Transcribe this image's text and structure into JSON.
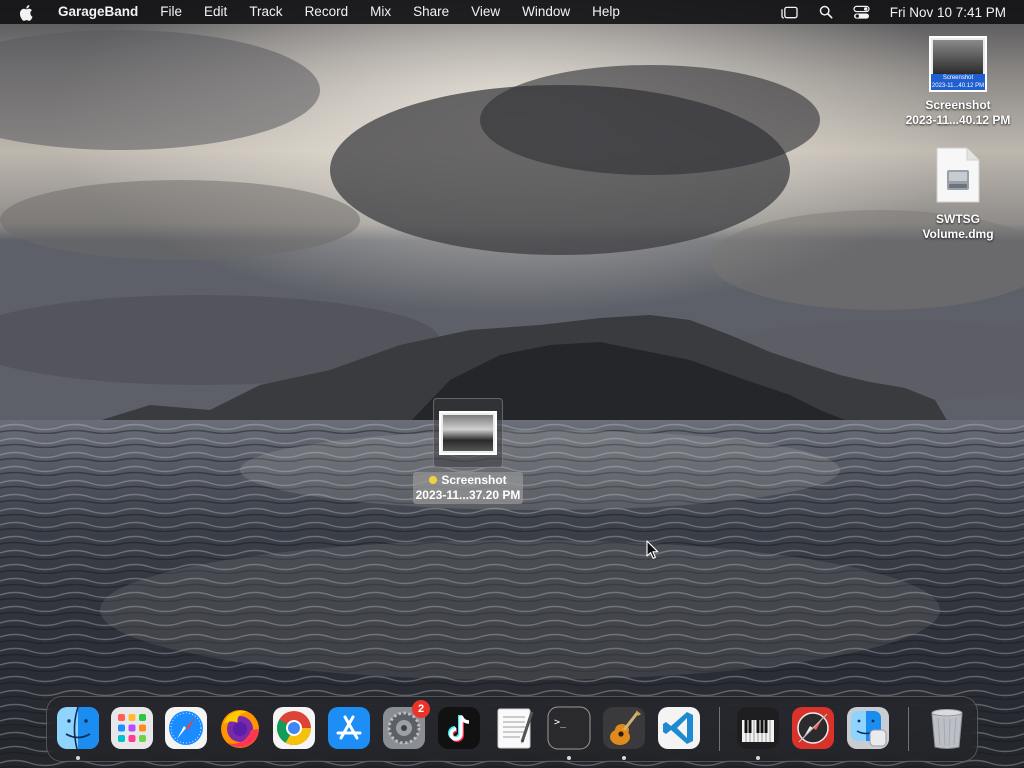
{
  "menubar": {
    "app_name": "GarageBand",
    "menus": [
      "File",
      "Edit",
      "Track",
      "Record",
      "Mix",
      "Share",
      "View",
      "Window",
      "Help"
    ],
    "status_icons": [
      "stage-manager-icon",
      "spotlight-search-icon",
      "control-center-icon"
    ],
    "clock": "Fri Nov 10  7:41 PM"
  },
  "desktop": {
    "icons": [
      {
        "name": "Screenshot",
        "subtitle": "2023-11...40.12 PM",
        "kind": "screenshot"
      },
      {
        "name": "SWTSG",
        "subtitle": "Volume.dmg",
        "kind": "disk-image"
      },
      {
        "name": "Screenshot",
        "subtitle": "2023-11...37.20 PM",
        "kind": "screenshot",
        "selected": true,
        "tag_color": "#f4d03f"
      }
    ],
    "thumb_caption": "Screenshot\n2023-11...40.12 PM"
  },
  "dock": {
    "apps": [
      {
        "name": "Finder",
        "icon": "finder-icon",
        "running": true
      },
      {
        "name": "Launchpad",
        "icon": "launchpad-icon",
        "running": false
      },
      {
        "name": "Safari",
        "icon": "safari-icon",
        "running": false
      },
      {
        "name": "Firefox",
        "icon": "firefox-icon",
        "running": false
      },
      {
        "name": "Google Chrome",
        "icon": "chrome-icon",
        "running": false
      },
      {
        "name": "App Store",
        "icon": "app-store-icon",
        "running": false
      },
      {
        "name": "System Settings",
        "icon": "system-settings-icon",
        "running": false,
        "badge": "2"
      },
      {
        "name": "TikTok",
        "icon": "tiktok-icon",
        "running": false
      },
      {
        "name": "TextEdit",
        "icon": "textedit-icon",
        "running": false
      },
      {
        "name": "Terminal",
        "icon": "terminal-icon",
        "running": true
      },
      {
        "name": "GarageBand",
        "icon": "garageband-icon",
        "running": true
      },
      {
        "name": "Visual Studio Code",
        "icon": "vscode-icon",
        "running": false
      },
      {
        "name": "MIDI Keyboard",
        "icon": "piano-icon",
        "running": true
      },
      {
        "name": "Compass Utility",
        "icon": "compass-icon",
        "running": false
      },
      {
        "name": "Finder Helper",
        "icon": "finder-alt-icon",
        "running": false
      },
      {
        "name": "Trash",
        "icon": "trash-icon",
        "running": false
      }
    ],
    "terminal_prompt": ">_"
  },
  "colors": {
    "menubar_bg": "#141416",
    "accent_blue": "#1f5fd0",
    "badge_red": "#e9332b"
  }
}
